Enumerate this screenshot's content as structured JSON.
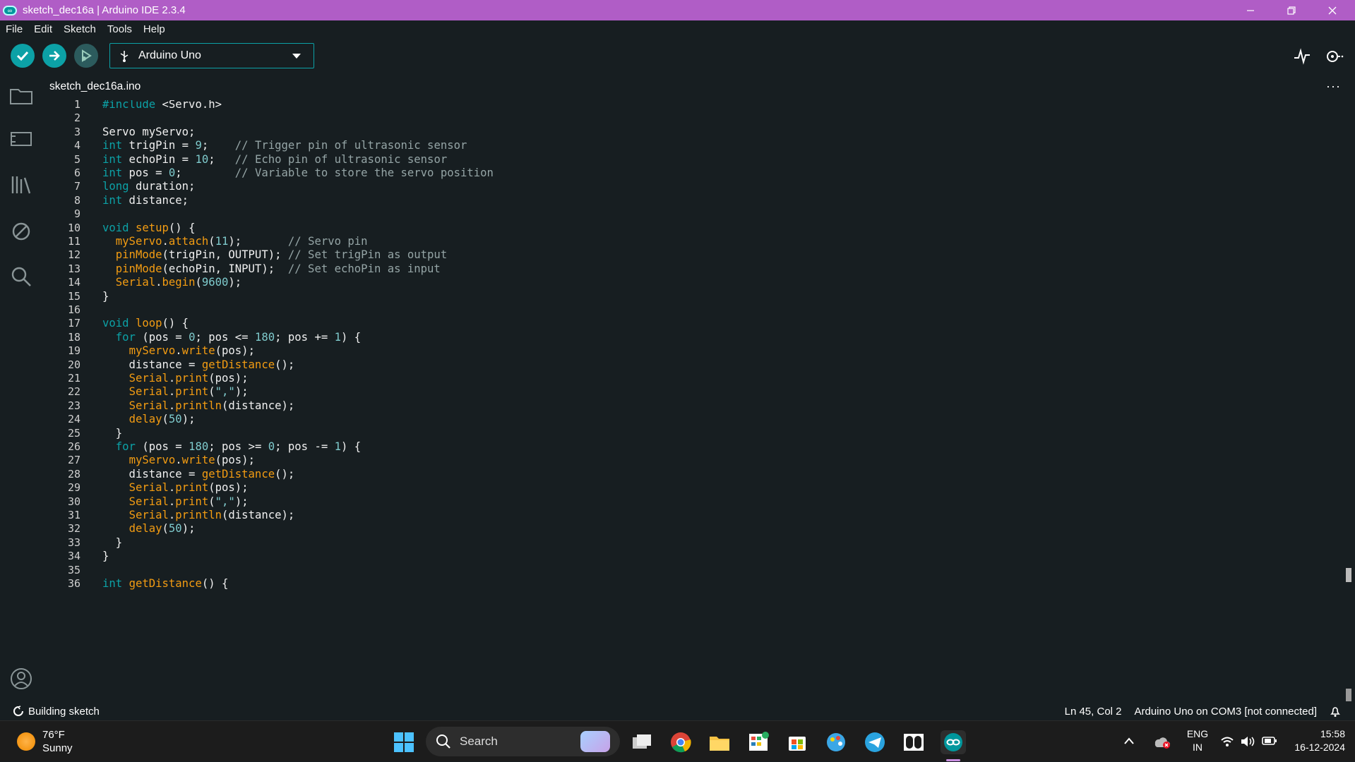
{
  "window": {
    "title": "sketch_dec16a | Arduino IDE 2.3.4"
  },
  "menu": [
    "File",
    "Edit",
    "Sketch",
    "Tools",
    "Help"
  ],
  "toolbar": {
    "board": "Arduino Uno"
  },
  "tab": {
    "filename": "sketch_dec16a.ino",
    "more": "···"
  },
  "code_lines": [
    {
      "n": "1",
      "html": "<span class='kw'>#include</span> &lt;Servo.h&gt;"
    },
    {
      "n": "2",
      "html": ""
    },
    {
      "n": "3",
      "html": "Servo myServo;"
    },
    {
      "n": "4",
      "html": "<span class='kw'>int</span> trigPin = <span class='num'>9</span>;    <span class='cm'>// Trigger pin of ultrasonic sensor</span>"
    },
    {
      "n": "5",
      "html": "<span class='kw'>int</span> echoPin = <span class='num'>10</span>;   <span class='cm'>// Echo pin of ultrasonic sensor</span>"
    },
    {
      "n": "6",
      "html": "<span class='kw'>int</span> pos = <span class='num'>0</span>;        <span class='cm'>// Variable to store the servo position</span>"
    },
    {
      "n": "7",
      "html": "<span class='kw'>long</span> duration;"
    },
    {
      "n": "8",
      "html": "<span class='kw'>int</span> distance;"
    },
    {
      "n": "9",
      "html": ""
    },
    {
      "n": "10",
      "html": "<span class='kw'>void</span> <span class='fn'>setup</span>() {"
    },
    {
      "n": "11",
      "html": "  <span class='fn'>myServo</span>.<span class='fn'>attach</span>(<span class='num'>11</span>);       <span class='cm'>// Servo pin</span>"
    },
    {
      "n": "12",
      "html": "  <span class='fn'>pinMode</span>(trigPin, OUTPUT); <span class='cm'>// Set trigPin as output</span>"
    },
    {
      "n": "13",
      "html": "  <span class='fn'>pinMode</span>(echoPin, INPUT);  <span class='cm'>// Set echoPin as input</span>"
    },
    {
      "n": "14",
      "html": "  <span class='fn'>Serial</span>.<span class='fn'>begin</span>(<span class='num'>9600</span>);"
    },
    {
      "n": "15",
      "html": "}"
    },
    {
      "n": "16",
      "html": ""
    },
    {
      "n": "17",
      "html": "<span class='kw'>void</span> <span class='fn'>loop</span>() {"
    },
    {
      "n": "18",
      "html": "  <span class='kw'>for</span> (pos = <span class='num'>0</span>; pos &lt;= <span class='num'>180</span>; pos += <span class='num'>1</span>) {"
    },
    {
      "n": "19",
      "html": "    <span class='fn'>myServo</span>.<span class='fn'>write</span>(pos);"
    },
    {
      "n": "20",
      "html": "    distance = <span class='fn'>getDistance</span>();"
    },
    {
      "n": "21",
      "html": "    <span class='fn'>Serial</span>.<span class='fn'>print</span>(pos);"
    },
    {
      "n": "22",
      "html": "    <span class='fn'>Serial</span>.<span class='fn'>print</span>(<span class='st'>\",\"</span>);"
    },
    {
      "n": "23",
      "html": "    <span class='fn'>Serial</span>.<span class='fn'>println</span>(distance);"
    },
    {
      "n": "24",
      "html": "    <span class='fn'>delay</span>(<span class='num'>50</span>);"
    },
    {
      "n": "25",
      "html": "  }"
    },
    {
      "n": "26",
      "html": "  <span class='kw'>for</span> (pos = <span class='num'>180</span>; pos &gt;= <span class='num'>0</span>; pos -= <span class='num'>1</span>) {"
    },
    {
      "n": "27",
      "html": "    <span class='fn'>myServo</span>.<span class='fn'>write</span>(pos);"
    },
    {
      "n": "28",
      "html": "    distance = <span class='fn'>getDistance</span>();"
    },
    {
      "n": "29",
      "html": "    <span class='fn'>Serial</span>.<span class='fn'>print</span>(pos);"
    },
    {
      "n": "30",
      "html": "    <span class='fn'>Serial</span>.<span class='fn'>print</span>(<span class='st'>\",\"</span>);"
    },
    {
      "n": "31",
      "html": "    <span class='fn'>Serial</span>.<span class='fn'>println</span>(distance);"
    },
    {
      "n": "32",
      "html": "    <span class='fn'>delay</span>(<span class='num'>50</span>);"
    },
    {
      "n": "33",
      "html": "  }"
    },
    {
      "n": "34",
      "html": "}"
    },
    {
      "n": "35",
      "html": ""
    },
    {
      "n": "36",
      "html": "<span class='kw'>int</span> <span class='fn'>getDistance</span>() {"
    }
  ],
  "status": {
    "left": "Building sketch",
    "cursor": "Ln 45, Col 2",
    "board": "Arduino Uno on COM3 [not connected]"
  },
  "taskbar": {
    "weather_temp": "76°F",
    "weather_cond": "Sunny",
    "search": "Search",
    "lang1": "ENG",
    "lang2": "IN",
    "time": "15:58",
    "date": "16-12-2024"
  },
  "colors": {
    "title_bar": "#b05dc6",
    "accent": "#0ca1a6",
    "bg": "#171e21"
  }
}
